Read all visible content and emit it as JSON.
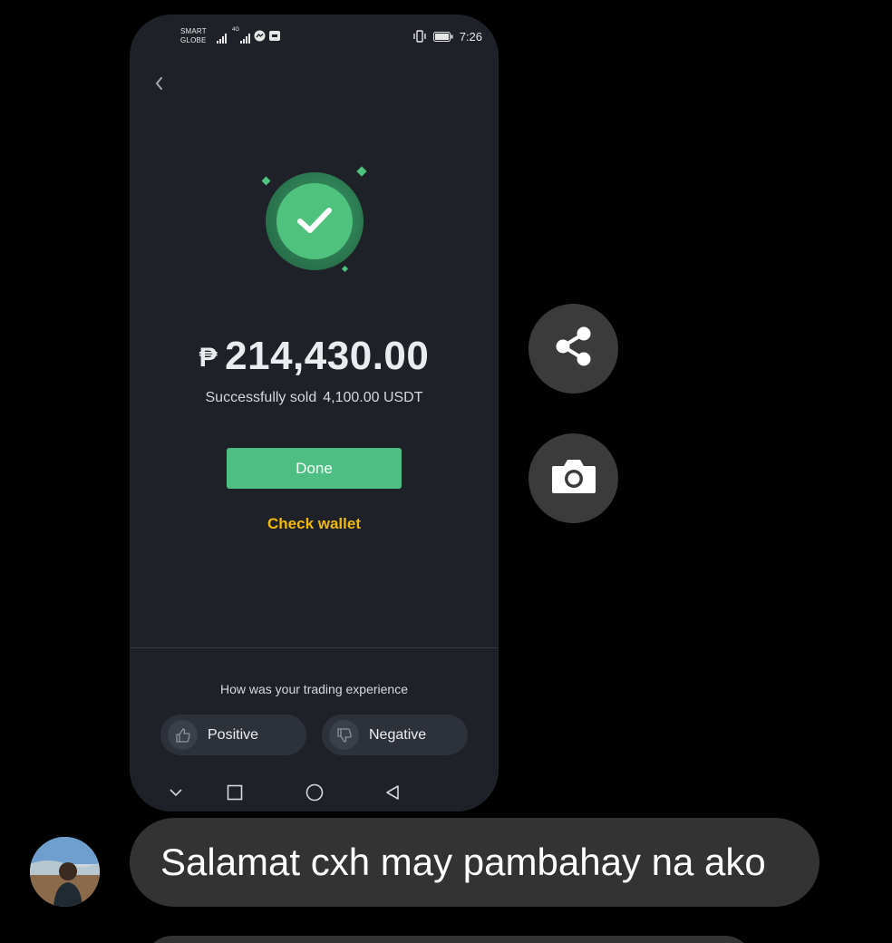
{
  "status_bar": {
    "carrier_line1": "SMART",
    "carrier_line2": "GLOBE",
    "network_label": "4G",
    "time": "7:26"
  },
  "result": {
    "currency_symbol": "₱",
    "amount": "214,430.00",
    "sold_label": "Successfully sold",
    "sold_value": "4,100.00 USDT"
  },
  "actions": {
    "done_label": "Done",
    "check_wallet_label": "Check wallet"
  },
  "feedback": {
    "question": "How was your trading experience",
    "positive_label": "Positive",
    "negative_label": "Negative"
  },
  "chat": {
    "message": "Salamat cxh may pambahay na ako"
  },
  "colors": {
    "accent_green": "#4fbe82",
    "wallet_yellow": "#f0b90b",
    "phone_bg": "#1e2127"
  },
  "icons": [
    "back-icon",
    "success-check-icon",
    "thumbs-up-icon",
    "thumbs-down-icon",
    "nav-down-icon",
    "nav-recent-icon",
    "nav-home-icon",
    "nav-back-icon",
    "share-icon",
    "camera-icon"
  ]
}
